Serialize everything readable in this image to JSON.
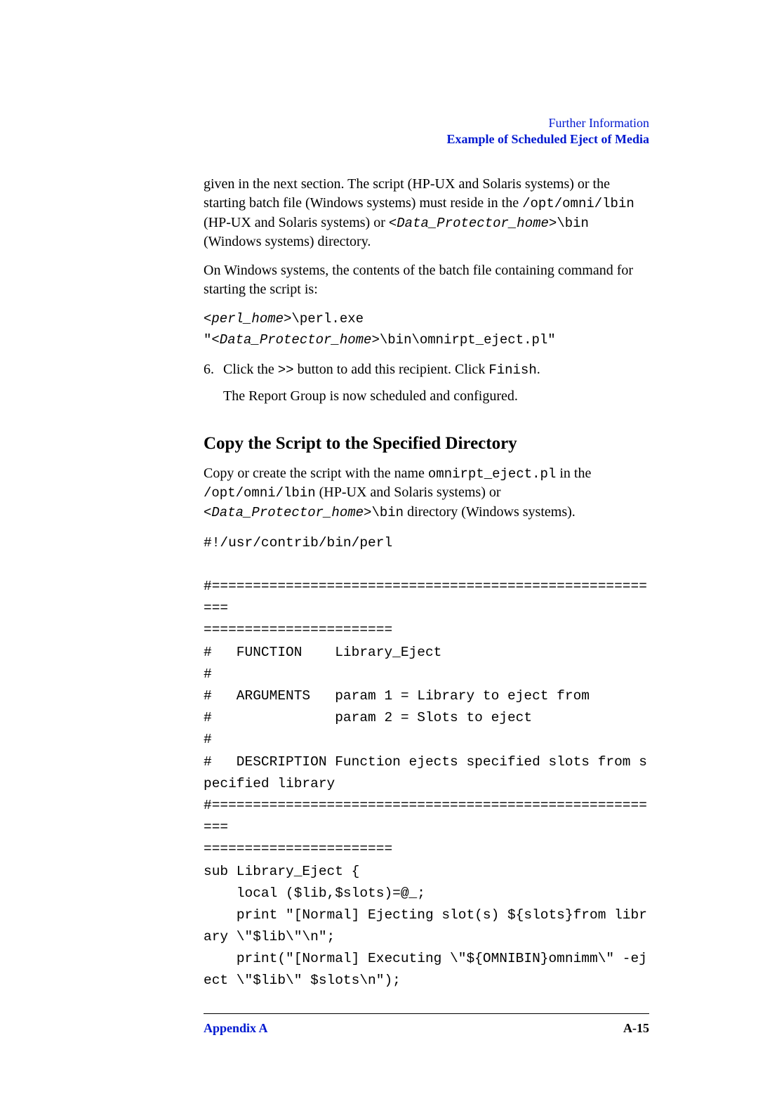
{
  "header": {
    "top": "Further Information",
    "sub": "Example of Scheduled Eject of Media"
  },
  "para1_a": "given in the next section. The script (HP-UX and Solaris systems) or the starting batch file (Windows systems) must reside in the ",
  "para1_mono1": "/opt/omni/lbin",
  "para1_b": " (HP-UX and Solaris systems) or ",
  "para1_mono2_i": "<Data_Protector_home>",
  "para1_mono2": "\\bin",
  "para1_c": " (Windows systems) directory.",
  "para2": "On Windows systems, the contents of the batch file containing command for starting the script is:",
  "cmd_line1_i": "<perl_home>",
  "cmd_line1": "\\perl.exe ",
  "cmd_line2_a": "\"",
  "cmd_line2_i": "<Data_Protector_home>",
  "cmd_line2_b": "\\bin\\omnirpt_eject.pl\"",
  "step6_num": "6.",
  "step6_a": "Click the ",
  "step6_m1": ">>",
  "step6_b": " button to add this recipient. Click ",
  "step6_m2": "Finish",
  "step6_c": ".",
  "step6_line2": "The Report Group is now scheduled and configured.",
  "section_title": "Copy the Script to the Specified Directory",
  "sec_a": "Copy or create the script with the name ",
  "sec_m1": "omnirpt_eject.pl",
  "sec_b": " in the ",
  "sec_m2": "/opt/omni/lbin",
  "sec_c": " (HP-UX and Solaris systems) or ",
  "sec_m3_i": "<Data_Protector_home>",
  "sec_m3": "\\bin",
  "sec_d": " directory (Windows systems).",
  "code": "#!/usr/contrib/bin/perl\n\n#========================================================\n=======================\n#   FUNCTION    Library_Eject\n#\n#   ARGUMENTS   param 1 = Library to eject from\n#               param 2 = Slots to eject \n#\n#   DESCRIPTION Function ejects specified slots from specified library\n#========================================================\n=======================\nsub Library_Eject {\n    local ($lib,$slots)=@_;\n    print \"[Normal] Ejecting slot(s) ${slots}from library \\\"$lib\\\"\\n\";\n    print(\"[Normal] Executing \\\"${OMNIBIN}omnimm\\\" -eject \\\"$lib\\\" $slots\\n\");",
  "footer": {
    "left": "Appendix A",
    "right": "A-15"
  }
}
